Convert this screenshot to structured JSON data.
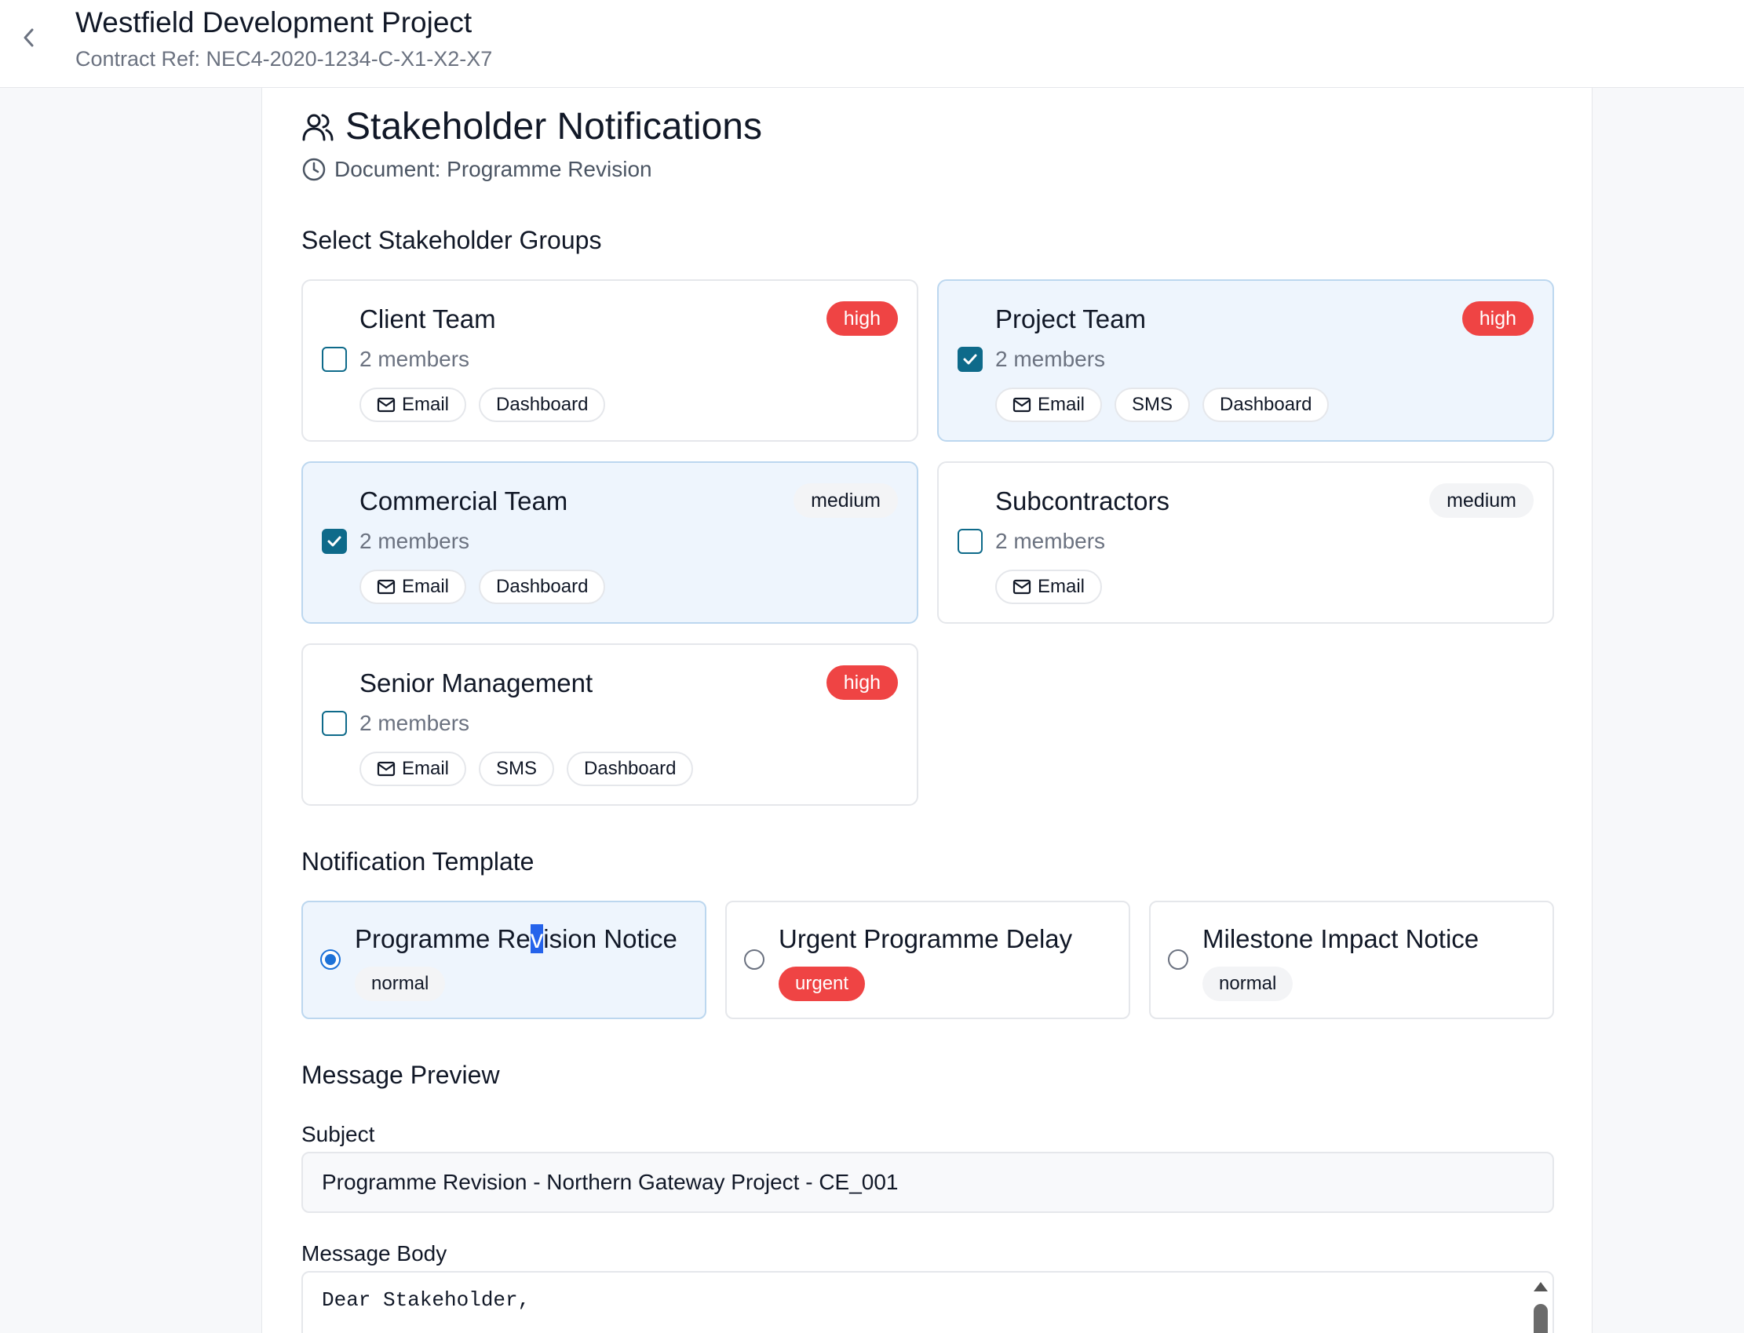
{
  "header": {
    "title": "Westfield Development Project",
    "contract_ref": "Contract Ref: NEC4-2020-1234-C-X1-X2-X7"
  },
  "page": {
    "title": "Stakeholder Notifications",
    "document_line": "Document: Programme Revision"
  },
  "groups_section": {
    "title": "Select Stakeholder Groups",
    "groups": [
      {
        "name": "Client Team",
        "members": "2 members",
        "priority": "high",
        "selected": false,
        "channels": [
          "Email",
          "Dashboard"
        ]
      },
      {
        "name": "Project Team",
        "members": "2 members",
        "priority": "high",
        "selected": true,
        "channels": [
          "Email",
          "SMS",
          "Dashboard"
        ]
      },
      {
        "name": "Commercial Team",
        "members": "2 members",
        "priority": "medium",
        "selected": true,
        "channels": [
          "Email",
          "Dashboard"
        ]
      },
      {
        "name": "Subcontractors",
        "members": "2 members",
        "priority": "medium",
        "selected": false,
        "channels": [
          "Email"
        ]
      },
      {
        "name": "Senior Management",
        "members": "2 members",
        "priority": "high",
        "selected": false,
        "channels": [
          "Email",
          "SMS",
          "Dashboard"
        ]
      }
    ]
  },
  "template_section": {
    "title": "Notification Template",
    "templates": [
      {
        "name": "Programme Revision Notice",
        "name_a": "Programme Re",
        "name_b": "v",
        "name_c": "ision Notice",
        "badge": "normal",
        "selected": true
      },
      {
        "name": "Urgent Programme Delay",
        "badge": "urgent",
        "selected": false
      },
      {
        "name": "Milestone Impact Notice",
        "badge": "normal",
        "selected": false
      }
    ]
  },
  "preview": {
    "title": "Message Preview",
    "subject_label": "Subject",
    "subject_value": "Programme Revision - Northern Gateway Project - CE_001",
    "body_label": "Message Body",
    "body_value": "Dear Stakeholder,"
  },
  "colors": {
    "high": "#ef4444",
    "selected_bg": "#eef5fd",
    "checkbox": "#0e6a8a",
    "radio": "#1d72d8"
  },
  "icons": {
    "back": "chevron-left-icon",
    "title": "users-icon",
    "document": "clock-icon",
    "email": "mail-icon",
    "check": "check-icon"
  }
}
